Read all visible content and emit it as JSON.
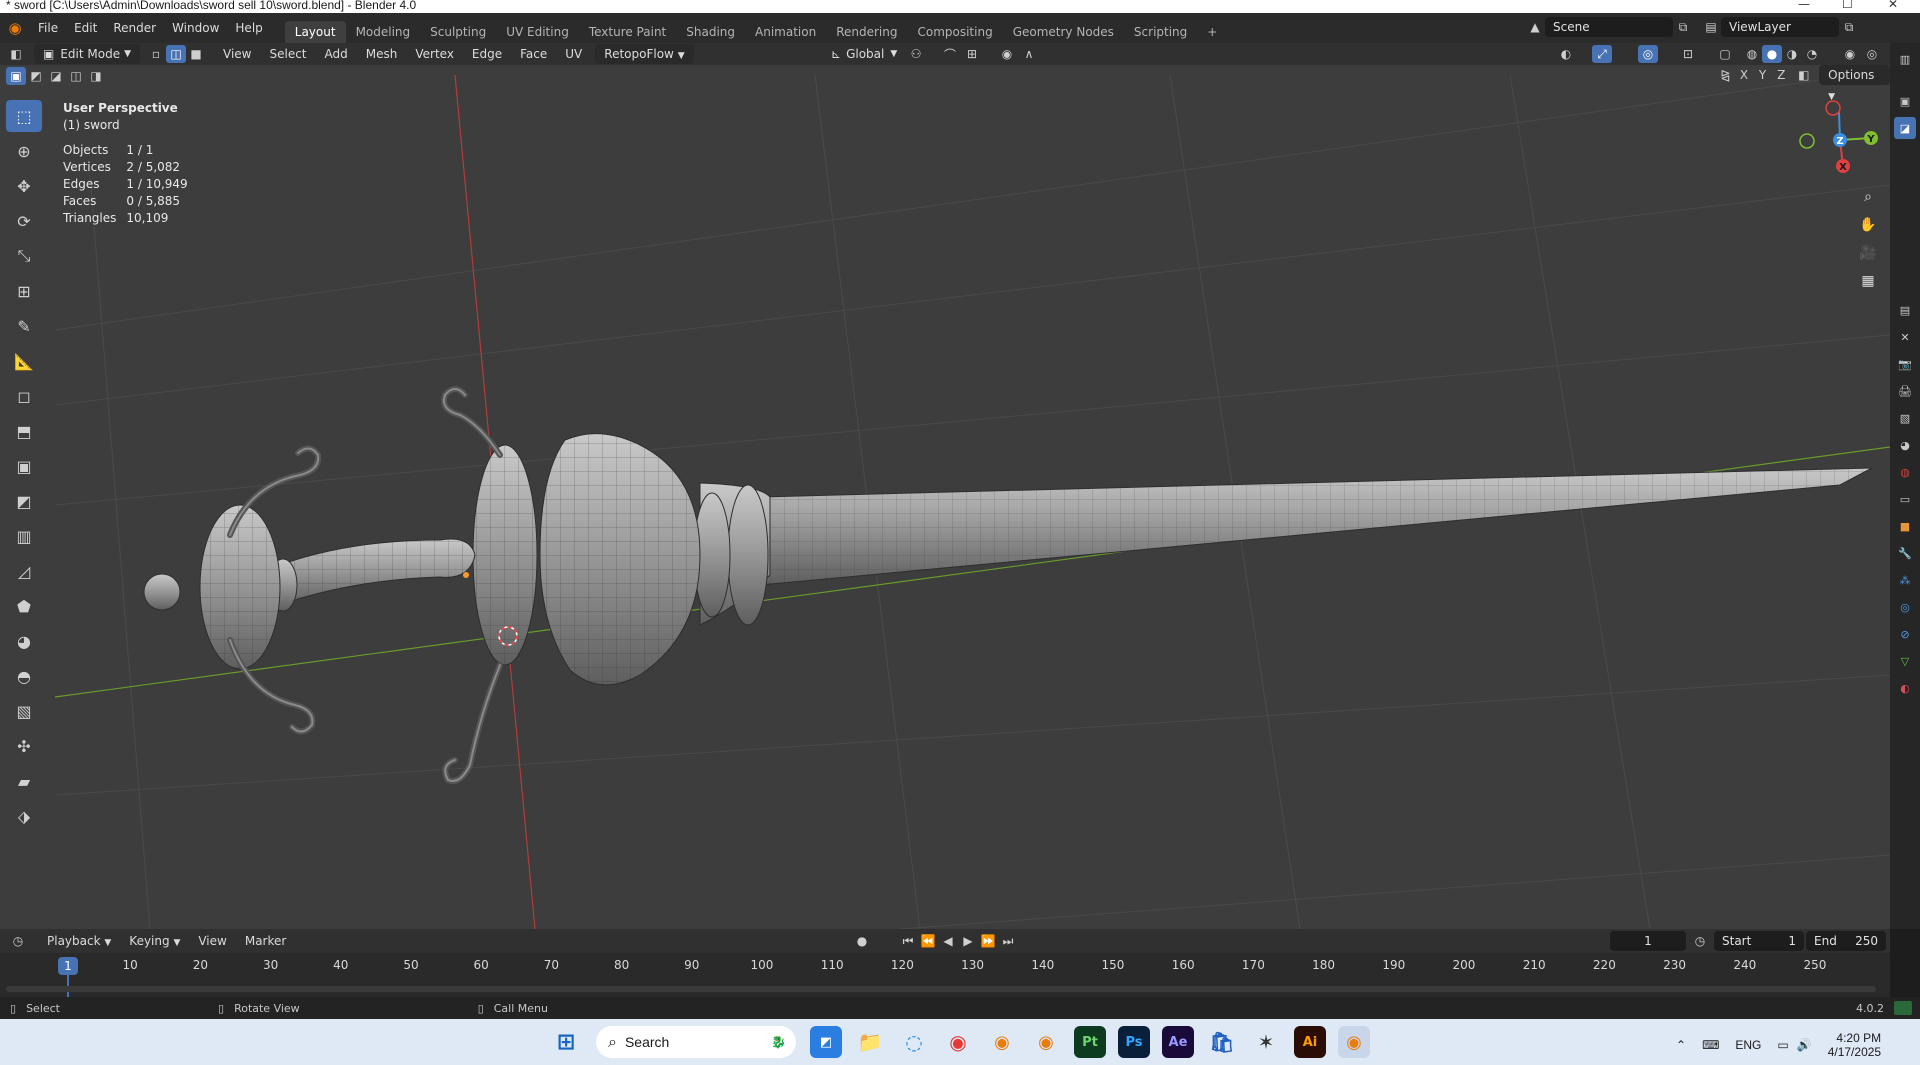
{
  "window": {
    "title": "* sword [C:\\Users\\Admin\\Downloads\\sword sell 10\\sword.blend] - Blender 4.0"
  },
  "menubar": {
    "items": [
      "File",
      "Edit",
      "Render",
      "Window",
      "Help"
    ],
    "workspaces": [
      "Layout",
      "Modeling",
      "Sculpting",
      "UV Editing",
      "Texture Paint",
      "Shading",
      "Animation",
      "Rendering",
      "Compositing",
      "Geometry Nodes",
      "Scripting"
    ],
    "active_workspace": "Layout",
    "scene_label": "Scene",
    "viewlayer_label": "ViewLayer"
  },
  "header": {
    "mode": "Edit Mode",
    "menus": [
      "View",
      "Select",
      "Add",
      "Mesh",
      "Vertex",
      "Edge",
      "Face",
      "UV"
    ],
    "addon_menu": "RetopoFlow",
    "orientation": "Global",
    "options_label": "Options",
    "axes": [
      "X",
      "Y",
      "Z"
    ]
  },
  "viewport": {
    "view_name": "User Perspective",
    "object_name": "(1) sword",
    "stats": [
      {
        "label": "Objects",
        "value": "1 / 1"
      },
      {
        "label": "Vertices",
        "value": "2 / 5,082"
      },
      {
        "label": "Edges",
        "value": "1 / 10,949"
      },
      {
        "label": "Faces",
        "value": "0 / 5,885"
      },
      {
        "label": "Triangles",
        "value": "10,109"
      }
    ],
    "gizmo_axes": [
      "Z",
      "Y",
      "X"
    ]
  },
  "timeline": {
    "menus": [
      "Playback",
      "Keying",
      "View",
      "Marker"
    ],
    "current_frame": "1",
    "start_label": "Start",
    "start_value": "1",
    "end_label": "End",
    "end_value": "250",
    "ticks": [
      "10",
      "20",
      "30",
      "40",
      "50",
      "60",
      "70",
      "80",
      "90",
      "100",
      "110",
      "120",
      "130",
      "140",
      "150",
      "160",
      "170",
      "180",
      "190",
      "200",
      "210",
      "220",
      "230",
      "240",
      "250"
    ],
    "playhead": "1"
  },
  "statusbar": {
    "select": "Select",
    "rotate": "Rotate View",
    "call_menu": "Call Menu",
    "version": "4.0.2"
  },
  "taskbar": {
    "search_placeholder": "Search",
    "lang": "ENG",
    "time": "4:20 PM",
    "date": "4/17/2025",
    "apps": [
      "Pt",
      "Ps",
      "Ae",
      "Ai"
    ]
  },
  "colors": {
    "accent": "#4772b3",
    "x_axis": "#e0403f",
    "y_axis": "#7fbf2f",
    "z_axis": "#3a8fe0",
    "viewport_bg": "#3d3d3d"
  }
}
